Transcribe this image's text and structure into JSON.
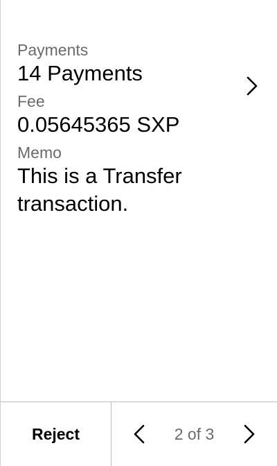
{
  "payments": {
    "label": "Payments",
    "value": "14 Payments"
  },
  "fee": {
    "label": "Fee",
    "value": "0.05645365 SXP"
  },
  "memo": {
    "label": "Memo",
    "value": "This is a Transfer transaction."
  },
  "footer": {
    "reject_label": "Reject",
    "pager_text": "2 of 3"
  },
  "icons": {
    "payments_chevron": "chevron-right-icon",
    "prev": "chevron-left-icon",
    "next": "chevron-right-icon"
  },
  "colors": {
    "label": "#6b6b6b",
    "value": "#000000",
    "divider": "#bdbdbd",
    "background": "#ffffff"
  }
}
